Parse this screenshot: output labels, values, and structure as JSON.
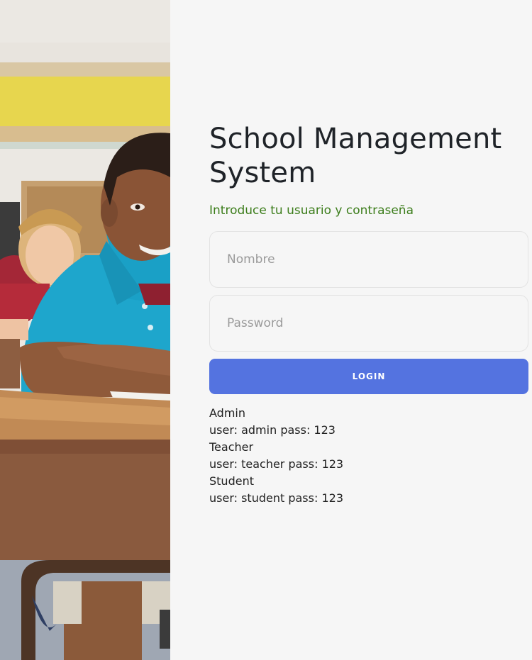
{
  "login": {
    "title": "School Management System",
    "subtitle": "Introduce tu usuario y contraseña",
    "username_placeholder": "Nombre",
    "password_placeholder": "Password",
    "button_label": "LOGIN"
  },
  "credentials": {
    "admin_heading": "Admin",
    "admin_line": "user: admin pass: 123",
    "teacher_heading": "Teacher",
    "teacher_line": "user: teacher pass: 123",
    "student_heading": "Student",
    "student_line": "user: student pass: 123"
  },
  "colors": {
    "accent": "#5473e0",
    "subtitle": "#3c7d1b",
    "background": "#f6f6f6"
  }
}
